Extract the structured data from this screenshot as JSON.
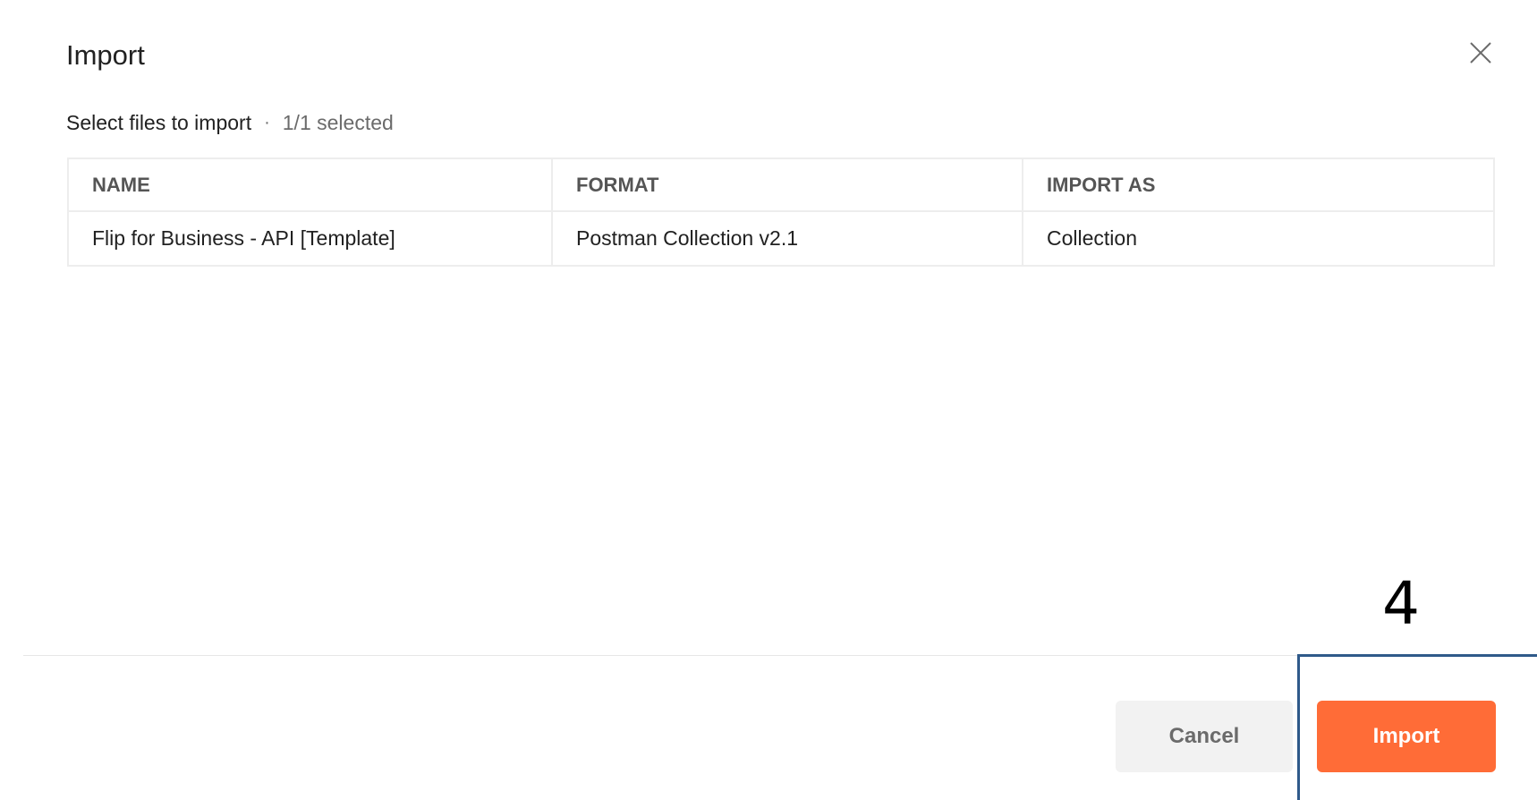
{
  "dialog": {
    "title": "Import",
    "close_icon": "close-icon"
  },
  "selection": {
    "label": "Select files to import",
    "separator": "·",
    "count": "1/1 selected"
  },
  "table": {
    "columns": [
      "NAME",
      "FORMAT",
      "IMPORT AS"
    ],
    "rows": [
      {
        "name": "Flip for Business - API [Template]",
        "format": "Postman Collection v2.1",
        "import_as": "Collection"
      }
    ]
  },
  "footer": {
    "cancel_label": "Cancel",
    "import_label": "Import"
  },
  "annotation": {
    "step": "4"
  },
  "colors": {
    "primary": "#ff6c37",
    "secondary_bg": "#f2f2f2",
    "highlight_border": "#2f5a8a"
  }
}
